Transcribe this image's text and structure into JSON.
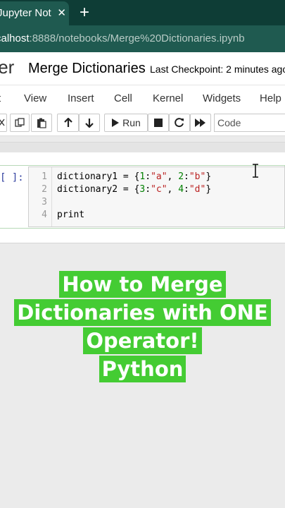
{
  "browser": {
    "tab_title": "Jupyter Not",
    "tab_close": "✕",
    "new_tab": "+",
    "url_host": "calhost",
    "url_path": ":8888/notebooks/Merge%20Dictionaries.ipynb"
  },
  "header": {
    "logo_text": "ter",
    "notebook_title": "Merge Dictionaries",
    "checkpoint": "Last Checkpoint: 2 minutes ago"
  },
  "menu": {
    "items": [
      "t",
      "View",
      "Insert",
      "Cell",
      "Kernel",
      "Widgets",
      "Help"
    ]
  },
  "toolbar": {
    "run_label": "Run",
    "cell_type": "Code"
  },
  "cell": {
    "prompt": "[ ]:",
    "lines": [
      {
        "num": "1",
        "code": "dictionary1 = {1:\"a\", 2:\"b\"}"
      },
      {
        "num": "2",
        "code": "dictionary2 = {3:\"c\", 4:\"d\"}"
      },
      {
        "num": "3",
        "code": ""
      },
      {
        "num": "4",
        "code": "print"
      }
    ]
  },
  "overlay": {
    "lines": [
      "How to Merge",
      "Dictionaries with ONE",
      "Operator!",
      "Python"
    ]
  },
  "colors": {
    "chrome_dark": "#0e3d36",
    "chrome": "#1f5a50",
    "overlay_green": "#44cc33"
  }
}
